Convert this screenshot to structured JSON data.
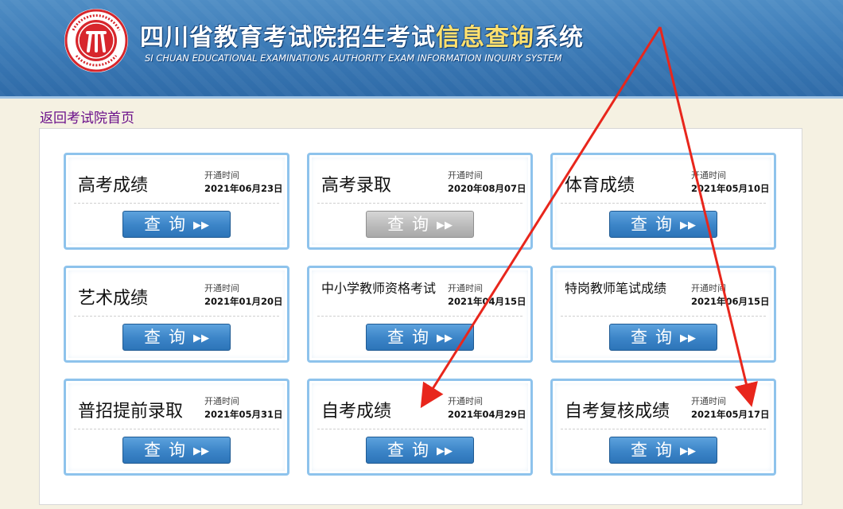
{
  "header": {
    "title_main": "四川省教育考试院招生考试",
    "title_highlight": "信息查询",
    "title_end": "系统",
    "subtitle": "SI CHUAN EDUCATIONAL EXAMINATIONS AUTHORITY EXAM INFORMATION INQUIRY SYSTEM",
    "logo_ring_text": "SICHUAN EDUCATIONAL EXAMINATIONS AUTHORITY",
    "logo_bottom_text": "四川省教育考试院",
    "logo_color": "#d7262c"
  },
  "nav": {
    "back_link": "返回考试院首页"
  },
  "common": {
    "open_label": "开通时间",
    "query_label": "查询",
    "arrow_icon": "double-chevron-right"
  },
  "cards": [
    {
      "title": "高考成绩",
      "date": "2021年06月23日",
      "enabled": true
    },
    {
      "title": "高考录取",
      "date": "2020年08月07日",
      "enabled": false
    },
    {
      "title": "体育成绩",
      "date": "2021年05月10日",
      "enabled": true
    },
    {
      "title": "艺术成绩",
      "date": "2021年01月20日",
      "enabled": true
    },
    {
      "title": "中小学教师资格考试",
      "date": "2021年04月15日",
      "enabled": true
    },
    {
      "title": "特岗教师笔试成绩",
      "date": "2021年06月15日",
      "enabled": true
    },
    {
      "title": "普招提前录取",
      "date": "2021年05月31日",
      "enabled": true
    },
    {
      "title": "自考成绩",
      "date": "2021年04月29日",
      "enabled": true
    },
    {
      "title": "自考复核成绩",
      "date": "2021年05月17日",
      "enabled": true
    }
  ],
  "annotation": {
    "arrow_color": "#e8261c"
  }
}
